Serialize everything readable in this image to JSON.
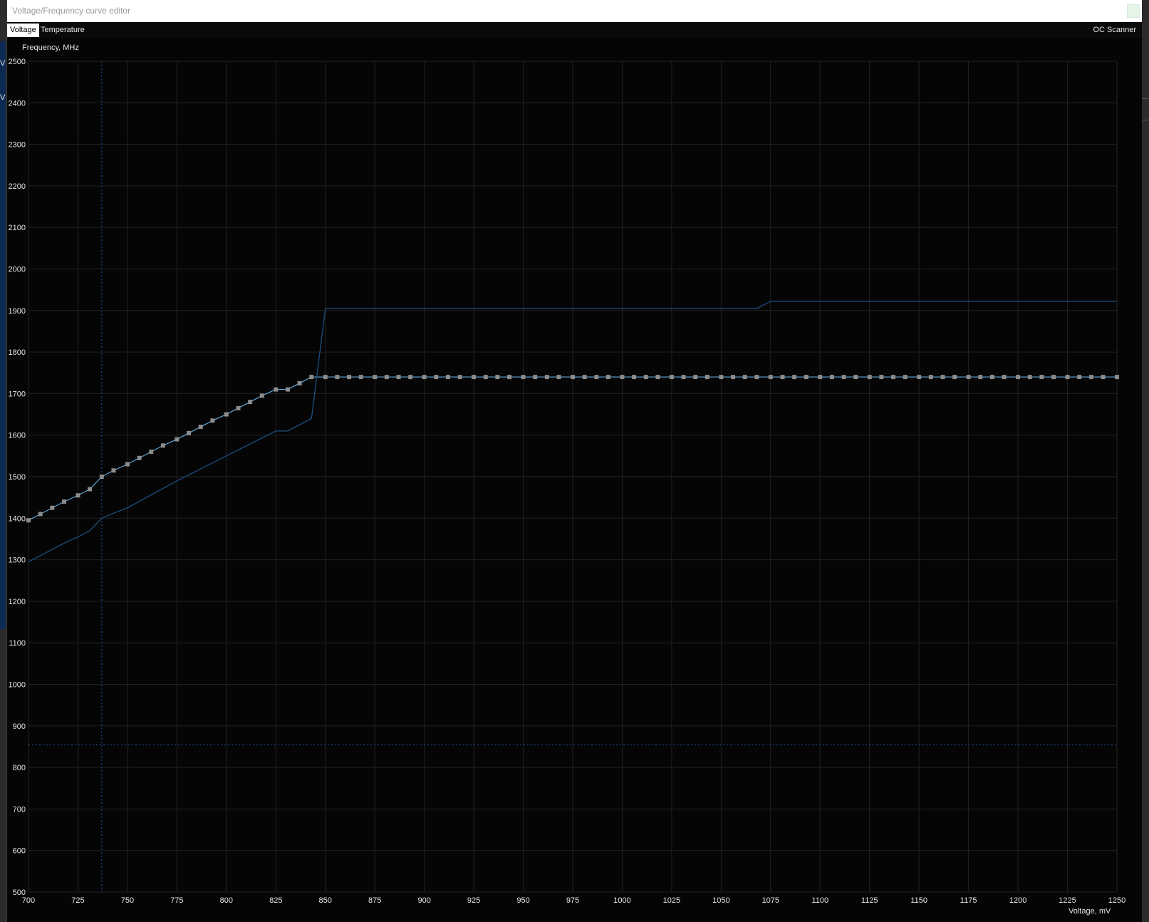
{
  "window": {
    "title": "Voltage/Frequency curve editor"
  },
  "tabs": [
    {
      "label": "Voltage",
      "active": true
    },
    {
      "label": "Temperature",
      "active": false
    }
  ],
  "oc_scanner_label": "OC Scanner",
  "backdrop_glyph": "V",
  "colors": {
    "background": "#050505",
    "grid": "#222222",
    "curve": "#5fa8d8",
    "points": "#8c8c8c",
    "reference_curve": "#1b4f7f",
    "marker": "#1e4fa0"
  },
  "chart_data": {
    "type": "line",
    "xlabel": "Voltage, mV",
    "ylabel": "Frequency, MHz",
    "xlim": [
      700,
      1250
    ],
    "ylim": [
      500,
      2500
    ],
    "x_ticks": [
      700,
      725,
      750,
      775,
      800,
      825,
      850,
      875,
      900,
      925,
      950,
      975,
      1000,
      1025,
      1050,
      1075,
      1100,
      1125,
      1150,
      1175,
      1200,
      1225,
      1250
    ],
    "y_ticks": [
      500,
      600,
      700,
      800,
      900,
      1000,
      1100,
      1200,
      1300,
      1400,
      1500,
      1600,
      1700,
      1800,
      1900,
      2000,
      2100,
      2200,
      2300,
      2400,
      2500
    ],
    "grid": true,
    "current_voltage_marker_mv": 737,
    "current_frequency_marker_mhz": 855,
    "series": [
      {
        "role": "curve",
        "x": [
          700,
          706,
          712,
          718,
          725,
          731,
          737,
          743,
          750,
          756,
          762,
          768,
          775,
          781,
          787,
          793,
          800,
          806,
          812,
          818,
          825,
          831,
          837,
          843,
          850,
          856,
          862,
          868,
          875,
          881,
          887,
          893,
          900,
          906,
          912,
          918,
          925,
          931,
          937,
          943,
          950,
          956,
          962,
          968,
          975,
          981,
          987,
          993,
          1000,
          1006,
          1012,
          1018,
          1025,
          1031,
          1037,
          1043,
          1050,
          1056,
          1062,
          1068,
          1075,
          1081,
          1087,
          1093,
          1100,
          1106,
          1112,
          1118,
          1125,
          1131,
          1137,
          1143,
          1150,
          1156,
          1162,
          1168,
          1175,
          1181,
          1187,
          1193,
          1200,
          1206,
          1212,
          1218,
          1225,
          1231,
          1237,
          1243,
          1250
        ],
        "y": [
          1395,
          1410,
          1425,
          1440,
          1455,
          1470,
          1500,
          1515,
          1530,
          1545,
          1560,
          1575,
          1590,
          1605,
          1620,
          1635,
          1650,
          1665,
          1680,
          1695,
          1710,
          1710,
          1725,
          1740,
          1740,
          1740,
          1740,
          1740,
          1740,
          1740,
          1740,
          1740,
          1740,
          1740,
          1740,
          1740,
          1740,
          1740,
          1740,
          1740,
          1740,
          1740,
          1740,
          1740,
          1740,
          1740,
          1740,
          1740,
          1740,
          1740,
          1740,
          1740,
          1740,
          1740,
          1740,
          1740,
          1740,
          1740,
          1740,
          1740,
          1740,
          1740,
          1740,
          1740,
          1740,
          1740,
          1740,
          1740,
          1740,
          1740,
          1740,
          1740,
          1740,
          1740,
          1740,
          1740,
          1740,
          1740,
          1740,
          1740,
          1740,
          1740,
          1740,
          1740,
          1740,
          1740,
          1740,
          1740,
          1740
        ],
        "points": true
      },
      {
        "role": "reference",
        "x": [
          700,
          718,
          725,
          731,
          737,
          743,
          750,
          775,
          800,
          825,
          831,
          837,
          843,
          850,
          1068,
          1075,
          1250
        ],
        "y": [
          1295,
          1340,
          1355,
          1370,
          1400,
          1412,
          1425,
          1490,
          1550,
          1610,
          1610,
          1625,
          1640,
          1905,
          1905,
          1922,
          1922
        ],
        "points": false
      }
    ]
  }
}
